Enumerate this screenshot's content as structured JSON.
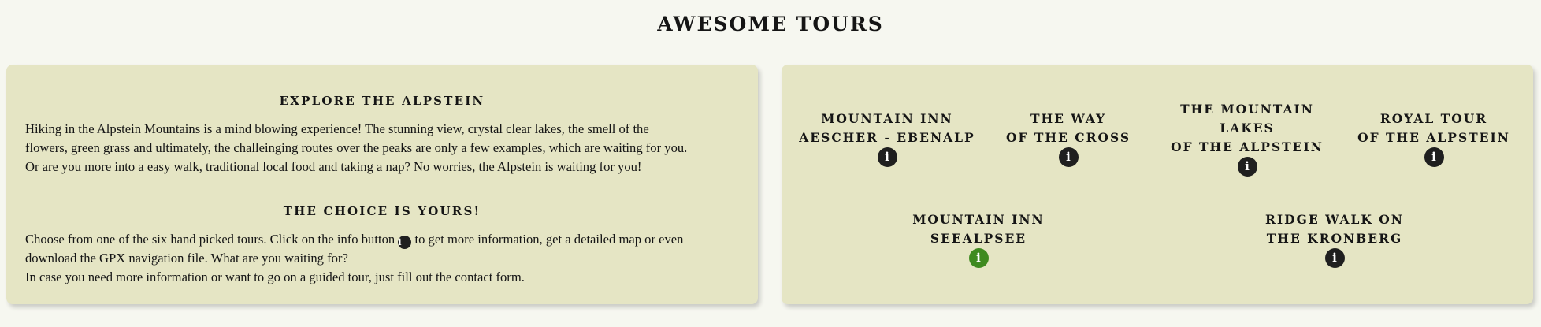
{
  "header": {
    "title": "AWESOME TOURS"
  },
  "intro": {
    "heading1": "EXPLORE THE ALPSTEIN",
    "para1_lines": [
      "Hiking in the Alpstein Mountains is a mind blowing experience! The stunning view, crystal clear lakes, the smell of the",
      "flowers, green grass and ultimately, the challeinging routes over the peaks are only a few examples, which are waiting for you.",
      "Or are you more into a easy walk, traditional local food and taking a nap? No worries, the Alpstein is waiting for you!"
    ],
    "heading2": "THE CHOICE IS YOURS!",
    "para2_line1_before": "Choose from one of the six hand picked tours. Click on the info button",
    "para2_line1_after": "to get more information, get a detailed map or even",
    "para2_line2": "download the GPX navigation file. What are you waiting for?",
    "para2_line3": "In case you need more information or want to go on a guided tour, just fill out the contact form.",
    "info_icon": "info-icon"
  },
  "tours": [
    {
      "lines": [
        "MOUNTAIN INN",
        "AESCHER - EBENALP"
      ],
      "info_icon": "info-icon",
      "active": false
    },
    {
      "lines": [
        "THE WAY",
        "OF THE CROSS"
      ],
      "info_icon": "info-icon",
      "active": false
    },
    {
      "lines": [
        "THE MOUNTAIN",
        "LAKES",
        "OF THE ALPSTEIN"
      ],
      "info_icon": "info-icon",
      "active": false
    },
    {
      "lines": [
        "ROYAL TOUR",
        "OF THE ALPSTEIN"
      ],
      "info_icon": "info-icon",
      "active": false
    },
    {
      "lines": [
        "MOUNTAIN INN",
        "SEEALPSEE"
      ],
      "info_icon": "info-icon",
      "active": true
    },
    {
      "lines": [
        "RIDGE WALK ON",
        "THE KRONBERG"
      ],
      "info_icon": "info-icon",
      "active": false
    }
  ],
  "colors": {
    "background": "#f6f7f0",
    "card": "#e5e5c4",
    "info_button": "#1f1f1f",
    "info_button_active": "#3e8a1f"
  }
}
